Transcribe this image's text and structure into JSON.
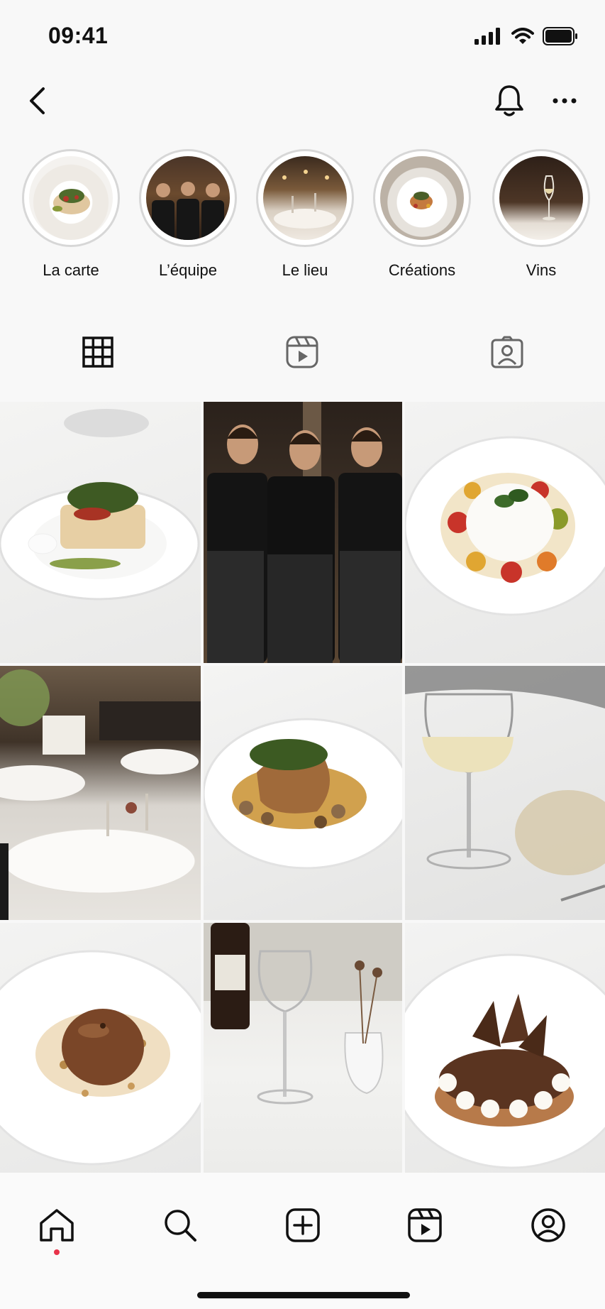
{
  "status_bar": {
    "time": "09:41"
  },
  "highlights": [
    {
      "label": "La carte",
      "icon": "plated-dish-photo"
    },
    {
      "label": "L’équipe",
      "icon": "team-photo"
    },
    {
      "label": "Le lieu",
      "icon": "dining-room-photo"
    },
    {
      "label": "Créations",
      "icon": "plated-creation-photo"
    },
    {
      "label": "Vins",
      "icon": "wine-glass-photo"
    }
  ],
  "tabs": [
    {
      "name": "posts-grid",
      "icon": "grid-icon",
      "active": true
    },
    {
      "name": "reels",
      "icon": "reels-icon",
      "active": false
    },
    {
      "name": "tagged",
      "icon": "tagged-icon",
      "active": false
    }
  ],
  "grid_posts": [
    {
      "subject": "fish dish on white plate"
    },
    {
      "subject": "three chefs in black aprons"
    },
    {
      "subject": "burrata with cherry tomatoes"
    },
    {
      "subject": "restaurant dining room"
    },
    {
      "subject": "braised meat with mushrooms"
    },
    {
      "subject": "glass of white wine"
    },
    {
      "subject": "chocolate dessert with crumble"
    },
    {
      "subject": "wine bottle and glasses on table"
    },
    {
      "subject": "chocolate tart with meringues"
    }
  ],
  "bottom_nav": [
    {
      "name": "home",
      "icon": "home-icon",
      "active": true
    },
    {
      "name": "search",
      "icon": "search-icon",
      "active": false
    },
    {
      "name": "create",
      "icon": "add-post-icon",
      "active": false
    },
    {
      "name": "reels",
      "icon": "reels-icon",
      "active": false
    },
    {
      "name": "profile",
      "icon": "profile-icon",
      "active": false
    }
  ],
  "colors": {
    "accent_dot": "#e8334a",
    "text": "#111111",
    "background": "#f8f8f8"
  }
}
